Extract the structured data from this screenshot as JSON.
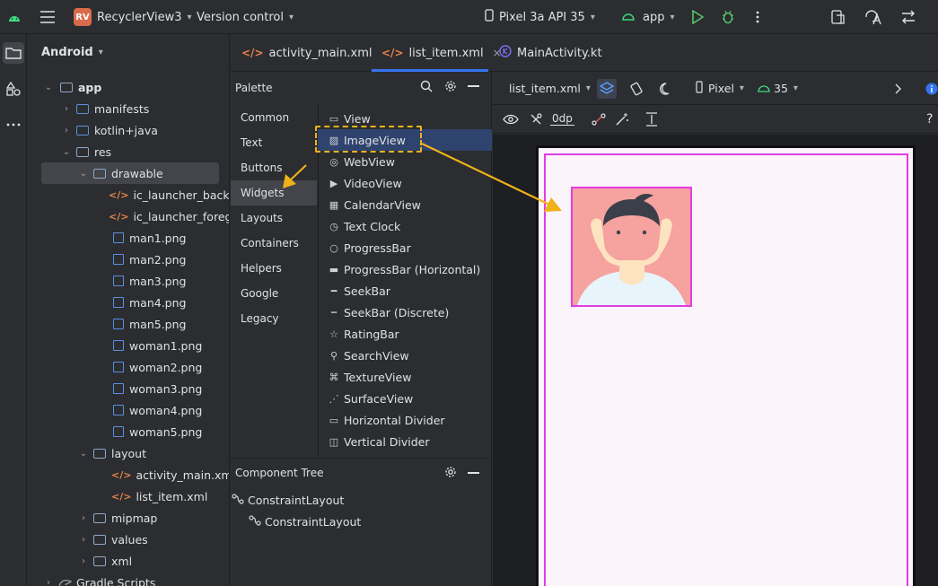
{
  "topbar": {
    "project_badge": "RV",
    "project_name": "RecyclerView3",
    "vcs": "Version control",
    "device": "Pixel 3a API 35",
    "run_config": "app"
  },
  "project_panel": {
    "view_mode": "Android",
    "tree": [
      {
        "label": "app",
        "bold": true
      },
      {
        "label": "manifests"
      },
      {
        "label": "kotlin+java"
      },
      {
        "label": "res"
      },
      {
        "label": "drawable"
      },
      {
        "label": "ic_launcher_backgrou"
      },
      {
        "label": "ic_launcher_foregrou"
      },
      {
        "label": "man1.png"
      },
      {
        "label": "man2.png"
      },
      {
        "label": "man3.png"
      },
      {
        "label": "man4.png"
      },
      {
        "label": "man5.png"
      },
      {
        "label": "woman1.png"
      },
      {
        "label": "woman2.png"
      },
      {
        "label": "woman3.png"
      },
      {
        "label": "woman4.png"
      },
      {
        "label": "woman5.png"
      },
      {
        "label": "layout"
      },
      {
        "label": "activity_main.xml"
      },
      {
        "label": "list_item.xml"
      },
      {
        "label": "mipmap"
      },
      {
        "label": "values"
      },
      {
        "label": "xml"
      },
      {
        "label": "Gradle Scripts"
      }
    ]
  },
  "tabs": [
    {
      "label": "activity_main.xml"
    },
    {
      "label": "list_item.xml"
    },
    {
      "label": "MainActivity.kt"
    }
  ],
  "palette": {
    "title": "Palette",
    "categories": [
      "Common",
      "Text",
      "Buttons",
      "Widgets",
      "Layouts",
      "Containers",
      "Helpers",
      "Google",
      "Legacy"
    ],
    "selected_category": "Widgets",
    "widgets": [
      "View",
      "ImageView",
      "WebView",
      "VideoView",
      "CalendarView",
      "Text Clock",
      "ProgressBar",
      "ProgressBar (Horizontal)",
      "SeekBar",
      "SeekBar (Discrete)",
      "RatingBar",
      "SearchView",
      "TextureView",
      "SurfaceView",
      "Horizontal Divider",
      "Vertical Divider"
    ],
    "selected_widget": "ImageView"
  },
  "component_tree": {
    "title": "Component Tree",
    "items": [
      "ConstraintLayout",
      "ConstraintLayout"
    ]
  },
  "design_toolbar": {
    "file": "list_item.xml",
    "device": "Pixel",
    "api": "35",
    "margin": "0dp"
  },
  "colors": {
    "accent": "#3574f0",
    "highlight": "#f0b21a",
    "outline": "#e23de3"
  }
}
